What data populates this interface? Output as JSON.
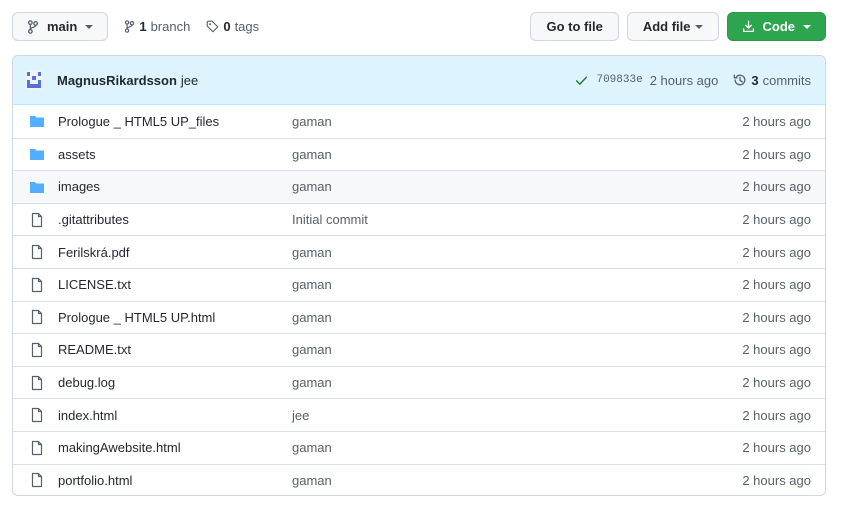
{
  "toolbar": {
    "branch_name": "main",
    "branch_count": "1",
    "branch_label": "branch",
    "tag_count": "0",
    "tag_label": "tags",
    "goto_label": "Go to file",
    "add_label": "Add file",
    "code_label": "Code"
  },
  "commit": {
    "author": "MagnusRikardsson",
    "message": "jee",
    "sha": "709833e",
    "time": "2 hours ago",
    "commit_count": "3",
    "commits_label": "commits"
  },
  "files": [
    {
      "name": "Prologue _ HTML5 UP_files",
      "type": "folder",
      "message": "gaman",
      "age": "2 hours ago"
    },
    {
      "name": "assets",
      "type": "folder",
      "message": "gaman",
      "age": "2 hours ago"
    },
    {
      "name": "images",
      "type": "folder",
      "message": "gaman",
      "age": "2 hours ago"
    },
    {
      "name": ".gitattributes",
      "type": "file",
      "message": "Initial commit",
      "age": "2 hours ago"
    },
    {
      "name": "Ferilskrá.pdf",
      "type": "file",
      "message": "gaman",
      "age": "2 hours ago"
    },
    {
      "name": "LICENSE.txt",
      "type": "file",
      "message": "gaman",
      "age": "2 hours ago"
    },
    {
      "name": "Prologue _ HTML5 UP.html",
      "type": "file",
      "message": "gaman",
      "age": "2 hours ago"
    },
    {
      "name": "README.txt",
      "type": "file",
      "message": "gaman",
      "age": "2 hours ago"
    },
    {
      "name": "debug.log",
      "type": "file",
      "message": "gaman",
      "age": "2 hours ago"
    },
    {
      "name": "index.html",
      "type": "file",
      "message": "jee",
      "age": "2 hours ago"
    },
    {
      "name": "makingAwebsite.html",
      "type": "file",
      "message": "gaman",
      "age": "2 hours ago"
    },
    {
      "name": "portfolio.html",
      "type": "file",
      "message": "gaman",
      "age": "2 hours ago"
    }
  ],
  "icons": {
    "branch": "git-branch-icon",
    "tag": "tag-icon",
    "download": "download-icon",
    "check": "check-icon",
    "history": "history-icon",
    "folder": "folder-icon",
    "file": "file-icon"
  },
  "colors": {
    "folder": "#54aeff",
    "code_button": "#2da44e",
    "header_bg": "#ddf4ff",
    "check": "#1a7f37"
  }
}
